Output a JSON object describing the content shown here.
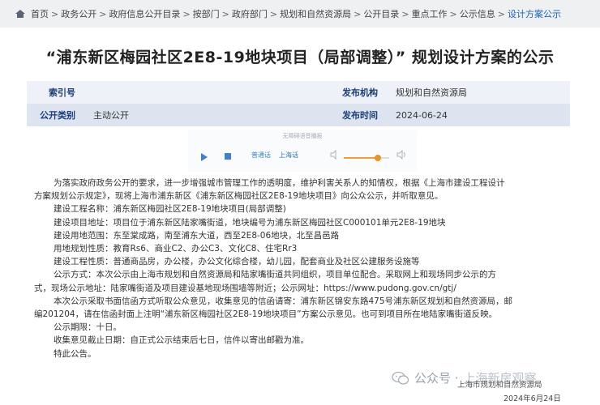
{
  "breadcrumb": {
    "items": [
      "首页",
      "政务公开",
      "政府信息公开目录",
      "按部门",
      "政府部门",
      "规划和自然资源局",
      "公开目录",
      "重点工作",
      "公示信息",
      "设计方案公示"
    ],
    "separator": ">"
  },
  "title": "“浦东新区梅园社区2E8-19地块项目（局部调整）” 规划设计方案的公示",
  "meta": {
    "index_label": "索引号",
    "index_value": "",
    "issuer_label": "发布机构",
    "issuer_value": "规划和自然资源局",
    "category_label": "公开类别",
    "category_value": "主动公开",
    "date_label": "发布时间",
    "date_value": "2024-06-24"
  },
  "player": {
    "hint": "无障碍语音播报",
    "mode_standard": "普通话",
    "mode_dialect": "上海话",
    "volume_level": 0.75
  },
  "body": {
    "lines": [
      "为落实政府政务公开的要求，进一步增强城市管理工作的透明度，维护利害关系人的知情权，根据《上海市建设工程设计",
      "方案规划公示规定》，现将上海市浦东新区《浦东新区梅园社区2E8-19地块项目》向公众公示，并听取意见。",
      "建设工程名称：浦东新区梅园社区2E8-19地块项目(局部调整)",
      "建设项目地址：项目位于浦东新区陆家嘴街道，地块编号为浦东新区梅园社区C000101单元2E8-19地块",
      "建设用地范围：东至棠成路，南至浦东大道，西至2E8-06地块，北至昌邑路",
      "用地规划性质：教育Rs6、商业C2、办公C3、文化C8、住宅Rr3",
      "建设工程性质：普通商品房，办公楼，办公文化综合楼，幼儿园，配套商业及社区公建服务设施等",
      "公示方式：本次公示由上海市规划和自然资源局和陆家嘴街道共同组织，项目单位配合。采取网上和现场同步公示的方",
      "式，现场公示地址：陆家嘴街道及项目建设基地现场围墙等附近；公示网址：https://www.pudong.gov.cn/gtj/",
      "本次公示采取书面信函方式听取公众意见，收集意见的信函请寄：浦东新区锦安东路475号浦东新区规划和自然资源局，邮",
      "编201204，请在信函封面上注明“浦东新区梅园社区2E8-19地块项目”方案公示意见。也可到项目所在地陆家嘴街道反映。",
      "公示期限：十日。",
      "收集意见截止日期：自正式公示结束后七日，信件以寄出邮戳为准。",
      "特此公告。"
    ]
  },
  "watermark": {
    "prefix": "公众号 ·",
    "name": "上海新房观察"
  },
  "signature": {
    "org": "上海市规划和自然资源局",
    "date": "2024年6月24日"
  },
  "colors": {
    "accent": "#1b63b4",
    "meta_key": "#1b3e7a",
    "player_blue": "#3b7fd8",
    "slider_orange": "#e8941e"
  }
}
